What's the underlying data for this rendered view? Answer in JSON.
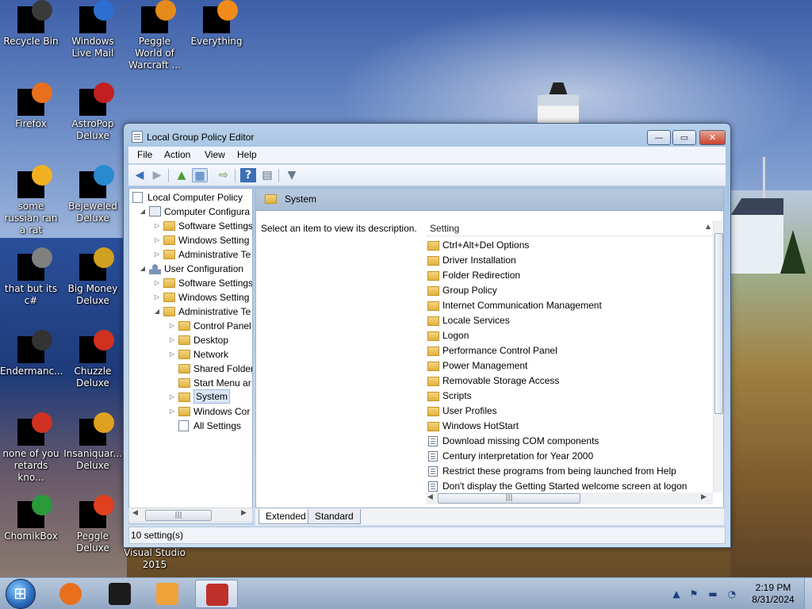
{
  "desktop": {
    "icons": [
      {
        "label": "Recycle Bin",
        "icon": "recycle-bin-icon"
      },
      {
        "label": "Windows Live Mail",
        "icon": "windows-live-mail-icon"
      },
      {
        "label": "Peggle World of Warcraft ...",
        "icon": "peggle-wow-icon"
      },
      {
        "label": "Everything",
        "icon": "everything-icon"
      },
      {
        "label": "Firefox",
        "icon": "firefox-icon"
      },
      {
        "label": "AstroPop Deluxe",
        "icon": "astropop-icon"
      },
      {
        "label": "some russian ran a rat",
        "icon": "app-icon"
      },
      {
        "label": "Bejeweled Deluxe",
        "icon": "bejeweled-icon"
      },
      {
        "label": "that but its c#",
        "icon": "app-icon"
      },
      {
        "label": "Big Money Deluxe",
        "icon": "big-money-icon"
      },
      {
        "label": "Endermanc...",
        "icon": "app-icon"
      },
      {
        "label": "Chuzzle Deluxe",
        "icon": "chuzzle-icon"
      },
      {
        "label": "none of you retards kno...",
        "icon": "app-icon"
      },
      {
        "label": "Insaniquar... Deluxe",
        "icon": "insaniquarium-icon"
      },
      {
        "label": "ChomikBox",
        "icon": "chomikbox-icon"
      },
      {
        "label": "Peggle Deluxe",
        "icon": "peggle-icon"
      },
      {
        "label": "Visual Studio 2015",
        "icon": "visual-studio-icon"
      }
    ]
  },
  "window": {
    "title": "Local Group Policy Editor",
    "caption_buttons": {
      "minimize": "—",
      "maximize": "▭",
      "close": "✕"
    }
  },
  "menu": [
    "File",
    "Action",
    "View",
    "Help"
  ],
  "toolbar": [
    {
      "icon": "back-arrow-icon",
      "glyph": "◀"
    },
    {
      "icon": "forward-arrow-icon",
      "glyph": "▶"
    },
    {
      "icon": "up-folder-icon",
      "glyph": "▲"
    },
    {
      "icon": "show-hide-tree-icon",
      "glyph": "▦"
    },
    {
      "icon": "export-list-icon",
      "glyph": "⇨"
    },
    {
      "icon": "help-icon",
      "glyph": "?"
    },
    {
      "icon": "properties-icon",
      "glyph": "▤"
    },
    {
      "icon": "filter-icon",
      "glyph": "▼"
    }
  ],
  "tree": [
    {
      "label": "Local Computer Policy",
      "icon": "document-icon",
      "arrow": ""
    },
    {
      "label": "Computer Configura",
      "icon": "computer-icon",
      "arrow": "◢"
    },
    {
      "label": "Software Settings",
      "icon": "folder-icon",
      "arrow": "▷"
    },
    {
      "label": "Windows Setting",
      "icon": "folder-icon",
      "arrow": "▷"
    },
    {
      "label": "Administrative Te",
      "icon": "folder-icon",
      "arrow": "▷"
    },
    {
      "label": "User Configuration",
      "icon": "user-icon",
      "arrow": "◢"
    },
    {
      "label": "Software Settings",
      "icon": "folder-icon",
      "arrow": "▷"
    },
    {
      "label": "Windows Setting",
      "icon": "folder-icon",
      "arrow": "▷"
    },
    {
      "label": "Administrative Te",
      "icon": "folder-icon",
      "arrow": "◢"
    },
    {
      "label": "Control Panel",
      "icon": "folder-icon",
      "arrow": "▷"
    },
    {
      "label": "Desktop",
      "icon": "folder-icon",
      "arrow": "▷"
    },
    {
      "label": "Network",
      "icon": "folder-icon",
      "arrow": "▷"
    },
    {
      "label": "Shared Folder",
      "icon": "folder-icon",
      "arrow": ""
    },
    {
      "label": "Start Menu ar",
      "icon": "folder-icon",
      "arrow": ""
    },
    {
      "label": "System",
      "icon": "folder-icon",
      "arrow": "▷",
      "selected": true
    },
    {
      "label": "Windows Cor",
      "icon": "folder-icon",
      "arrow": "▷"
    },
    {
      "label": "All Settings",
      "icon": "all-settings-icon",
      "arrow": ""
    }
  ],
  "section": {
    "title": "System",
    "description": "Select an item to view its description.",
    "column_header": "Setting"
  },
  "settings": [
    {
      "label": "Ctrl+Alt+Del Options",
      "type": "folder"
    },
    {
      "label": "Driver Installation",
      "type": "folder"
    },
    {
      "label": "Folder Redirection",
      "type": "folder"
    },
    {
      "label": "Group Policy",
      "type": "folder"
    },
    {
      "label": "Internet Communication Management",
      "type": "folder"
    },
    {
      "label": "Locale Services",
      "type": "folder"
    },
    {
      "label": "Logon",
      "type": "folder"
    },
    {
      "label": "Performance Control Panel",
      "type": "folder"
    },
    {
      "label": "Power Management",
      "type": "folder"
    },
    {
      "label": "Removable Storage Access",
      "type": "folder"
    },
    {
      "label": "Scripts",
      "type": "folder"
    },
    {
      "label": "User Profiles",
      "type": "folder"
    },
    {
      "label": "Windows HotStart",
      "type": "folder"
    },
    {
      "label": "Download missing COM components",
      "type": "setting"
    },
    {
      "label": "Century interpretation for Year 2000",
      "type": "setting"
    },
    {
      "label": "Restrict these programs from being launched from Help",
      "type": "setting"
    },
    {
      "label": "Don't display the Getting Started welcome screen at logon",
      "type": "setting"
    }
  ],
  "tabs": [
    "Extended",
    "Standard"
  ],
  "status": "10 setting(s)",
  "taskbar": {
    "items": [
      {
        "icon": "firefox-icon",
        "color": "#e8701c"
      },
      {
        "icon": "terminal-icon",
        "color": "#1b1b1b"
      },
      {
        "icon": "media-player-icon",
        "color": "#f0a23a"
      },
      {
        "icon": "group-policy-editor-icon",
        "color": "#c0302a",
        "active": true
      }
    ],
    "tray": [
      {
        "icon": "show-hidden-icons-icon",
        "glyph": "▲"
      },
      {
        "icon": "action-center-icon",
        "glyph": "⚑"
      },
      {
        "icon": "monitor-icon",
        "glyph": "▬"
      },
      {
        "icon": "network-icon",
        "glyph": "◔"
      }
    ],
    "time": "2:19 PM",
    "date": "8/31/2024"
  },
  "colors": {
    "accent": "#3d6db5",
    "folder": "#e2b23e",
    "selection": "#d9e6f5"
  }
}
